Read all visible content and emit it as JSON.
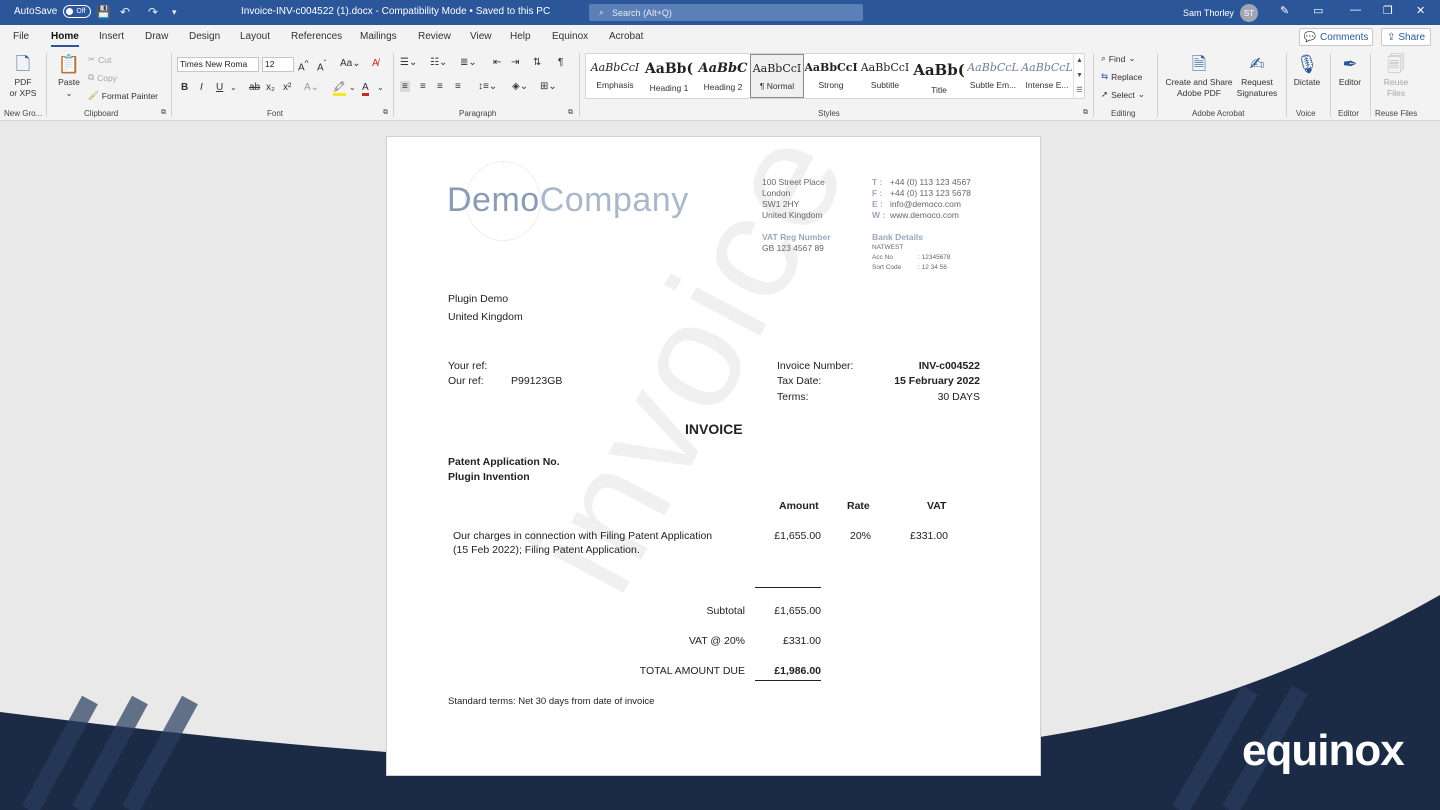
{
  "titlebar": {
    "autosave_label": "AutoSave",
    "autosave_state": "Off",
    "doc_title": "Invoice-INV-c004522 (1).docx  -  Compatibility Mode  •  Saved to this PC",
    "search_placeholder": "Search (Alt+Q)",
    "user_name": "Sam Thorley",
    "user_initials": "ST"
  },
  "tabs": [
    "File",
    "Home",
    "Insert",
    "Draw",
    "Design",
    "Layout",
    "References",
    "Mailings",
    "Review",
    "View",
    "Help",
    "Equinox",
    "Acrobat"
  ],
  "actions": {
    "comments": "Comments",
    "share": "Share"
  },
  "ribbon": {
    "pdf_label_1": "PDF",
    "pdf_label_2": "or XPS",
    "new_group_label": "New Gro...",
    "paste": "Paste",
    "cut": "Cut",
    "copy": "Copy",
    "format_painter": "Format Painter",
    "clipboard_label": "Clipboard",
    "font_name": "Times New Roma",
    "font_size": "12",
    "font_label": "Font",
    "paragraph_label": "Paragraph",
    "styles": [
      {
        "preview": "AaBbCcI",
        "name": "Emphasis"
      },
      {
        "preview": "AaBb(",
        "name": "Heading 1"
      },
      {
        "preview": "AaBbC",
        "name": "Heading 2"
      },
      {
        "preview": "AaBbCcI",
        "name": "¶ Normal"
      },
      {
        "preview": "AaBbCcI",
        "name": "Strong"
      },
      {
        "preview": "AaBbCcI",
        "name": "Subtitle"
      },
      {
        "preview": "AaBb(",
        "name": "Title"
      },
      {
        "preview": "AaBbCcL",
        "name": "Subtle Em..."
      },
      {
        "preview": "AaBbCcL",
        "name": "Intense E..."
      }
    ],
    "styles_label": "Styles",
    "find": "Find",
    "replace": "Replace",
    "select": "Select",
    "editing_label": "Editing",
    "create_share_1": "Create and Share",
    "create_share_2": "Adobe PDF",
    "request_sig_1": "Request",
    "request_sig_2": "Signatures",
    "acrobat_label": "Adobe Acrobat",
    "dictate": "Dictate",
    "voice_label": "Voice",
    "editor": "Editor",
    "editor_label": "Editor",
    "reuse_1": "Reuse",
    "reuse_2": "Files",
    "reuse_label": "Reuse Files"
  },
  "invoice": {
    "company_1": "Demo",
    "company_2": "Company",
    "address": [
      "100 Street Place",
      "London",
      "SW1 2HY",
      "United Kingdom"
    ],
    "contacts": [
      {
        "k": "T",
        "v": "+44 (0) 113 123 4567"
      },
      {
        "k": "F",
        "v": "+44 (0) 113 123 5678"
      },
      {
        "k": "E",
        "v": "info@democo.com"
      },
      {
        "k": "W",
        "v": "www.democo.com"
      }
    ],
    "vat_label": "VAT Reg Number",
    "vat_number": "GB 123 4567 89",
    "bank_label": "Bank Details",
    "bank_name": "NATWEST",
    "acc_label": "Acc No",
    "acc_value": ": 12345678",
    "sort_label": "Sort Code",
    "sort_value": ": 12 34 56",
    "client_name": "Plugin Demo",
    "client_country": "United Kingdom",
    "your_ref_label": "Your ref:",
    "our_ref_label": "Our ref:",
    "our_ref_value": "P99123GB",
    "inv_num_label": "Invoice Number:",
    "inv_num_value": "INV-c004522",
    "tax_date_label": "Tax Date:",
    "tax_date_value": "15 February 2022",
    "terms_label": "Terms:",
    "terms_value": "30 DAYS",
    "heading": "INVOICE",
    "patent_label": "Patent Application No.",
    "invention_label": "Plugin Invention",
    "col_amount": "Amount",
    "col_rate": "Rate",
    "col_vat": "VAT",
    "line_desc_1": "Our charges in connection with Filing Patent Application",
    "line_desc_2": "(15 Feb 2022); Filing Patent Application.",
    "line_amount": "£1,655.00",
    "line_rate": "20%",
    "line_vat": "£331.00",
    "subtotal_label": "Subtotal",
    "subtotal_value": "£1,655.00",
    "vat_total_label": "VAT @ 20%",
    "vat_total_value": "£331.00",
    "total_label": "TOTAL AMOUNT DUE",
    "total_value": "£1,986.00",
    "footer_terms": "Standard terms: Net 30 days from date of invoice",
    "watermark": "invoice"
  },
  "brand": {
    "name": "equinox",
    "color": "#1c2b45"
  }
}
